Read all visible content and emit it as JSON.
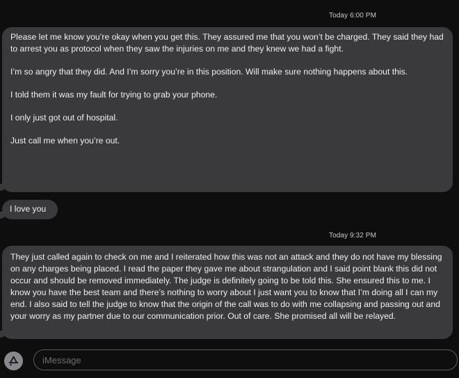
{
  "conversation": {
    "timestamp_1": "Today 6:00 PM",
    "timestamp_2": "Today 9:32 PM",
    "message_1_paragraphs": [
      "Please let me know you’re okay when you get this. They assured me that you won’t be charged. They said they had to arrest you as protocol when they saw the injuries on me and they knew we had a fight.",
      "I’m so angry that they did. And I’m sorry you’re in this position. Will make sure nothing happens about this.",
      "I told them it was my fault for trying to grab your phone.",
      "I only just got out of hospital.",
      "Just call me when you’re out."
    ],
    "message_2": "I love you",
    "message_3": "They just called again to check on me and I reiterated how this was not an attack and they do not have my blessing on any charges being placed. I read the paper they gave me about strangulation and I said point blank this did not occur and should be removed immediately. The judge is definitely going to be told this. She ensured this to me. I know you have the best team and there’s nothing to worry about I just want you to know that I’m doing all I can my end. I also said to tell the judge to know that the origin of the call was to do with me collapsing and passing out and your worry as my partner due to our communication prior. Out of care. She promised all will be relayed."
  },
  "composer": {
    "placeholder": "iMessage",
    "app_button_icon": "app-store-icon"
  }
}
